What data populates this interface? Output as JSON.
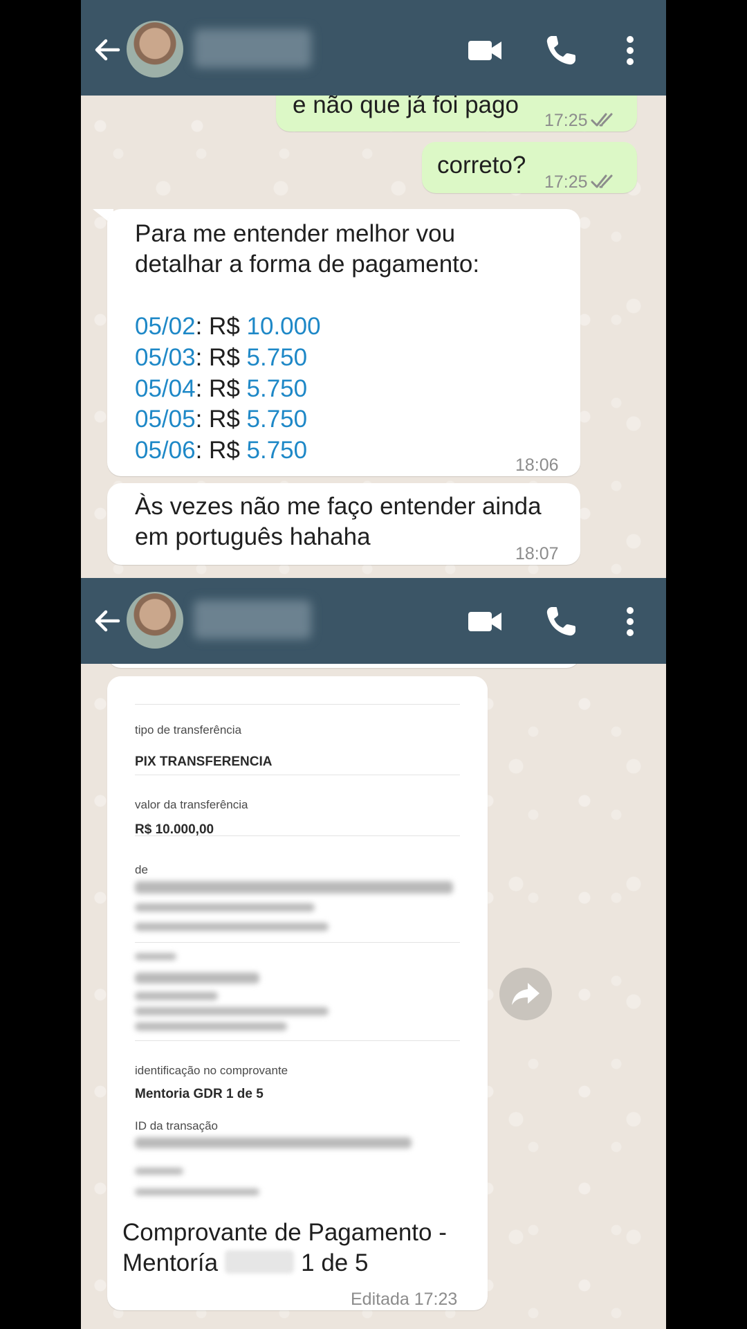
{
  "screens": [
    {
      "header": {
        "contact_name_hidden": true
      },
      "messages": [
        {
          "text": "e não que já foi pago",
          "time": "17:25"
        },
        {
          "text": "correto?",
          "time": "17:25"
        },
        {
          "lines": [
            "Para me entender melhor vou",
            "detalhar a forma de pagamento:"
          ],
          "payments": [
            {
              "date": "05/02",
              "sep": ": R$ ",
              "amount": "10.000"
            },
            {
              "date": "05/03",
              "sep": ": R$ ",
              "amount": "5.750"
            },
            {
              "date": "05/04",
              "sep": ": R$ ",
              "amount": "5.750"
            },
            {
              "date": "05/05",
              "sep": ": R$ ",
              "amount": "5.750"
            },
            {
              "date": "05/06",
              "sep": ": R$ ",
              "amount": "5.750"
            }
          ],
          "time": "18:06"
        },
        {
          "lines": [
            "Às vezes não me faço entender ainda",
            "em português hahaha"
          ],
          "time": "18:07"
        }
      ]
    },
    {
      "receipt": {
        "tipo_label": "tipo de transferência",
        "tipo_value": "PIX TRANSFERENCIA",
        "valor_label": "valor da transferência",
        "valor_value": "R$ 10.000,00",
        "de_label": "de",
        "ident_label": "identificação no comprovante",
        "ident_value": "Mentoria GDR 1 de 5",
        "id_label": "ID da transação"
      },
      "caption": {
        "line1": "Comprovante de Pagamento -",
        "line2_a": "Mentoría",
        "line2_b": "1 de 5",
        "time": "Editada 17:23"
      }
    }
  ],
  "colors": {
    "header_bg": "#3b5566",
    "chat_bg": "#ece5dd",
    "outgoing_bubble": "#dcf8c6",
    "incoming_bubble": "#ffffff",
    "link_blue": "#1e88c7",
    "read_ticks": "#8c8c8c"
  },
  "icons": [
    "back-arrow-icon",
    "video-call-icon",
    "phone-icon",
    "more-vert-icon",
    "double-check-icon",
    "forward-icon"
  ]
}
